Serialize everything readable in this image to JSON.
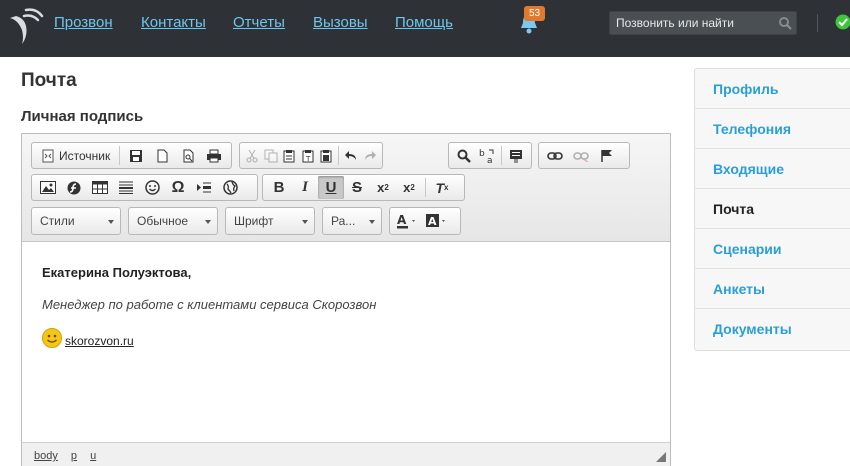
{
  "nav": {
    "items": [
      "Прозвон",
      "Контакты",
      "Отчеты",
      "Вызовы",
      "Помощь"
    ],
    "notifications_count": "53",
    "search_placeholder": "Позвонить или найти"
  },
  "page": {
    "title": "Почта",
    "section_title": "Личная подпись"
  },
  "editor": {
    "source_label": "Источник",
    "combos": [
      "Стили",
      "Обычное",
      "Шрифт",
      "Ра..."
    ],
    "signature": {
      "name": "Екатерина Полуэктова,",
      "role": "Менеджер по работе с клиентами сервиса Скорозвон",
      "link": "skorozvon.ru"
    },
    "path": [
      "body",
      "p",
      "u"
    ]
  },
  "sidebar": {
    "items": [
      "Профиль",
      "Телефония",
      "Входящие",
      "Почта",
      "Сценарии",
      "Анкеты",
      "Документы"
    ],
    "active": "Почта"
  },
  "colors": {
    "topbar": "#2e3236",
    "nav_link": "#6cc6ee",
    "sidebar_link": "#2a9fd6",
    "badge": "#e07b2e",
    "status_ok": "#3ec43e"
  }
}
